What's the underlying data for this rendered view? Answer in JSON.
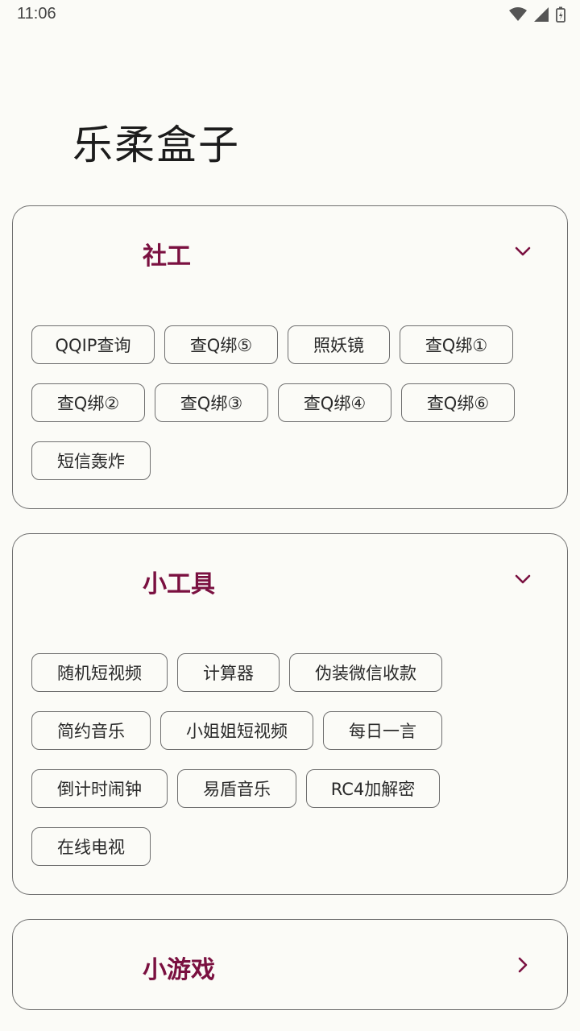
{
  "status": {
    "time": "11:06"
  },
  "app": {
    "title": "乐柔盒子"
  },
  "sections": {
    "social": {
      "title": "社工",
      "rows": [
        [
          "QQIP查询",
          "查Q绑⑤",
          "照妖镜",
          "查Q绑①"
        ],
        [
          "查Q绑②",
          "查Q绑③",
          "查Q绑④",
          "查Q绑⑥"
        ],
        [
          "短信轰炸"
        ]
      ]
    },
    "tools": {
      "title": "小工具",
      "rows": [
        [
          "随机短视频",
          "计算器",
          "伪装微信收款"
        ],
        [
          "简约音乐",
          "小姐姐短视频",
          "每日一言"
        ],
        [
          "倒计时闹钟",
          "易盾音乐",
          "RC4加解密"
        ],
        [
          "在线电视"
        ]
      ]
    },
    "games": {
      "title": "小游戏"
    }
  },
  "colors": {
    "accent": "#7a1040",
    "background": "#fbfbf7",
    "border": "#6f6f6f"
  },
  "icons": {
    "expanded": "chevron-down-icon",
    "collapsed": "chevron-right-icon"
  }
}
